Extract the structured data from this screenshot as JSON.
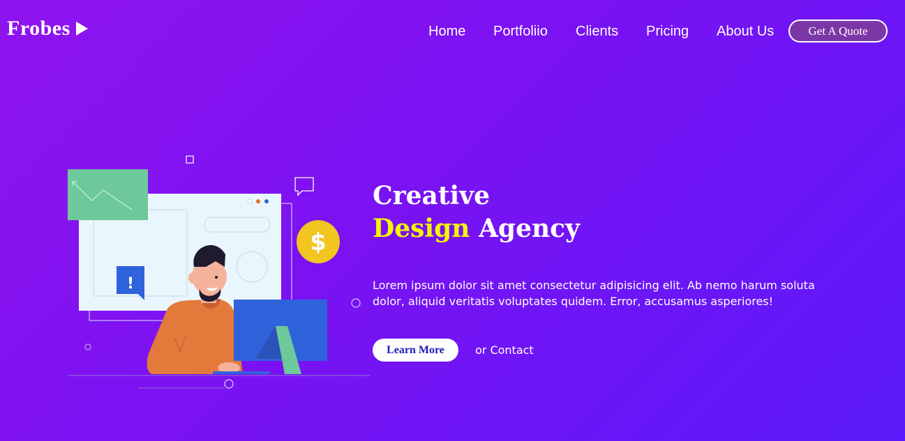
{
  "header": {
    "logo_text": "Frobes",
    "logo_icon": "play-icon",
    "nav": [
      "Home",
      "Portfoliio",
      "Clients",
      "Pricing",
      "About Us"
    ],
    "cta_label": "Get A Quote"
  },
  "hero": {
    "title_line1": "Creative",
    "title_highlight": "Design",
    "title_rest": "Agency",
    "description": "Lorem ipsum dolor sit amet consectetur adipisicing elit. Ab nemo harum soluta dolor, aliquid veritatis voluptates quidem. Error, accusamus asperiores!",
    "learn_more": "Learn More",
    "contact": "or Contact"
  },
  "colors": {
    "bg_start": "#8f14ef",
    "bg_end": "#5b1afb",
    "highlight": "#f5f500",
    "cta_bg": "#7c37a6",
    "learn_text": "#1b1bb5"
  },
  "illustration": {
    "icons": [
      "chart-card-icon",
      "alert-icon",
      "dollar-coin-icon",
      "chat-bubble-icon",
      "person-at-computer"
    ],
    "coin_symbol": "$",
    "alert_symbol": "!"
  }
}
